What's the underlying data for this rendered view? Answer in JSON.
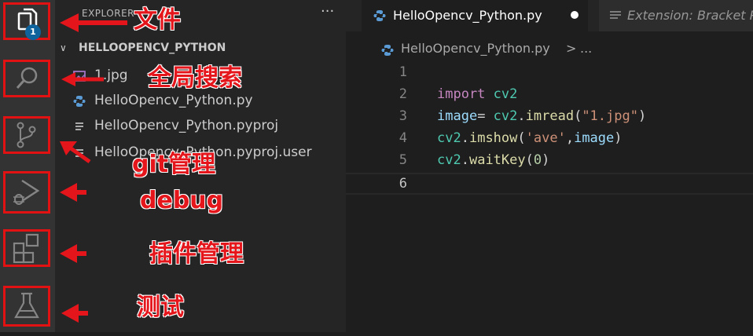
{
  "activity_bar": {
    "items": [
      {
        "icon": "files-icon",
        "badge": "1"
      },
      {
        "icon": "search-icon"
      },
      {
        "icon": "source-control-icon"
      },
      {
        "icon": "run-debug-icon"
      },
      {
        "icon": "extensions-icon"
      },
      {
        "icon": "testing-flask-icon"
      }
    ]
  },
  "sidebar": {
    "title": "EXPLORER",
    "more": "···",
    "folder": "HELLOOPENCV_PYTHON",
    "files": [
      {
        "name": "1.jpg",
        "icon": "image-file-icon"
      },
      {
        "name": "HelloOpencv_Python.py",
        "icon": "python-file-icon"
      },
      {
        "name": "HelloOpencv_Python.pyproj",
        "icon": "text-file-icon"
      },
      {
        "name": "HelloOpencv_Python.pyproj.user",
        "icon": "text-file-icon"
      }
    ]
  },
  "tabs": [
    {
      "label": "HelloOpencv_Python.py",
      "icon": "python-file-icon",
      "dirty": true
    },
    {
      "label": "Extension: Bracket P",
      "icon": "extension-preview-icon"
    }
  ],
  "breadcrumb": {
    "file": "HelloOpencv_Python.py",
    "separator": ">",
    "ellipsis": "..."
  },
  "code": {
    "line_numbers": [
      "1",
      "2",
      "3",
      "4",
      "5",
      "6"
    ],
    "current_line": "6",
    "lines": [
      {
        "tokens": []
      },
      {
        "tokens": [
          {
            "t": "import",
            "c": "kw"
          },
          {
            "t": " ",
            "c": "plain"
          },
          {
            "t": "cv2",
            "c": "mod"
          }
        ]
      },
      {
        "tokens": [
          {
            "t": "image",
            "c": "var"
          },
          {
            "t": "= ",
            "c": "plain"
          },
          {
            "t": "cv2",
            "c": "mod"
          },
          {
            "t": ".",
            "c": "plain"
          },
          {
            "t": "imread",
            "c": "fn"
          },
          {
            "t": "(",
            "c": "plain"
          },
          {
            "t": "\"1.jpg\"",
            "c": "str"
          },
          {
            "t": ")",
            "c": "plain"
          }
        ]
      },
      {
        "tokens": [
          {
            "t": "cv2",
            "c": "mod"
          },
          {
            "t": ".",
            "c": "plain"
          },
          {
            "t": "imshow",
            "c": "fn"
          },
          {
            "t": "(",
            "c": "plain"
          },
          {
            "t": "'ave'",
            "c": "str"
          },
          {
            "t": ",",
            "c": "plain"
          },
          {
            "t": "image",
            "c": "var"
          },
          {
            "t": ")",
            "c": "plain"
          }
        ]
      },
      {
        "tokens": [
          {
            "t": "cv2",
            "c": "mod"
          },
          {
            "t": ".",
            "c": "plain"
          },
          {
            "t": "waitKey",
            "c": "fn"
          },
          {
            "t": "(",
            "c": "plain"
          },
          {
            "t": "0",
            "c": "num"
          },
          {
            "t": ")",
            "c": "plain"
          }
        ]
      },
      {
        "tokens": []
      }
    ]
  },
  "annotations": {
    "files": "文件",
    "search": "全局搜索",
    "git": "git管理",
    "debug": "debug",
    "extensions": "插件管理",
    "testing": "测试"
  },
  "colors": {
    "annotation": "#e4151b",
    "activity_bar": "#333333",
    "sidebar": "#252526",
    "editor": "#1e1e1e"
  }
}
